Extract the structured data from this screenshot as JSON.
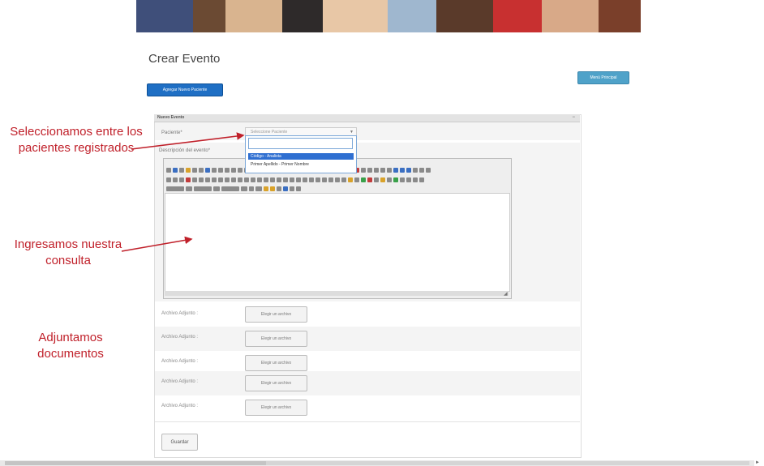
{
  "page": {
    "title": "Crear Evento",
    "add_patient_button": "Agregar Nuevo Paciente",
    "menu_button": "Menú Principal"
  },
  "panel": {
    "header": "Nuevo Evento",
    "collapse_icon": "minus-icon",
    "patient_label": "Paciente*",
    "patient_placeholder": "Seleccione Paciente",
    "dropdown_options": [
      "Código - Analista",
      "Primer Apellido - Primer Nombre"
    ],
    "description_label": "Descripción del evento*",
    "attachments": [
      {
        "label": "Archivo Adjunto :",
        "button": "Elegir un archivo"
      },
      {
        "label": "Archivo Adjunto :",
        "button": "Elegir un archivo"
      },
      {
        "label": "Archivo Adjunto :",
        "button": "Elegir un archivo"
      },
      {
        "label": "Archivo Adjunto :",
        "button": "Elegir un archivo"
      },
      {
        "label": "Archivo Adjunto :",
        "button": "Elegir un archivo"
      }
    ],
    "submit_button": "Guardar"
  },
  "annotations": {
    "select_patient": "Seleccionamos entre los pacientes registrados",
    "enter_query": "Ingresamos nuestra consulta",
    "attach_docs": "Adjuntamos documentos"
  },
  "colors": {
    "annotation": "#c0202a",
    "primary_button": "#1f6fc4",
    "menu_button": "#4fa2c9",
    "selected_option": "#2f6fd1"
  }
}
